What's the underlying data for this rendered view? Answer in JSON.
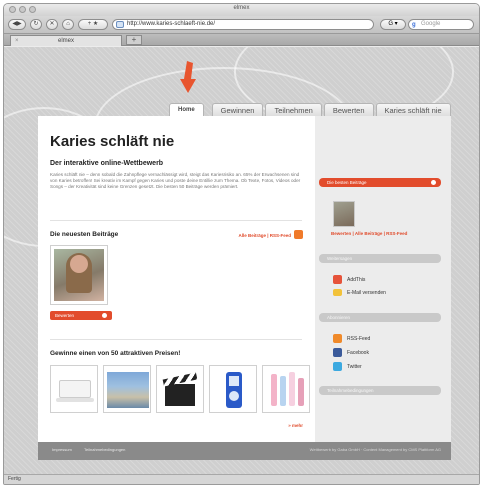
{
  "window": {
    "title": "elmex"
  },
  "toolbar": {
    "url": "http://www.karies-schlaeft-nie.de/",
    "search_engine": "Google",
    "search_placeholder": "Google"
  },
  "browser_tab": {
    "label": "elmex"
  },
  "nav_tabs": [
    {
      "label": "Home",
      "active": true
    },
    {
      "label": "Gewinnen",
      "active": false
    },
    {
      "label": "Teilnehmen",
      "active": false
    },
    {
      "label": "Bewerten",
      "active": false
    },
    {
      "label": "Karies schläft nie",
      "active": false
    }
  ],
  "main": {
    "title": "Karies schläft nie",
    "subtitle": "Der interaktive online-Wettbewerb",
    "intro": "Karies schläft nie – denn sobald die Zahnpflege vernachlässigt wird, steigt das Kariesrisiko an. 65% der Erwachsenen sind von Karies betroffen! Sei kreativ im Kampf gegen Karies und poste deine Entillie zum Thema. Ob Texte, Fotos, Videos oder Songs – der Kreativität sind keine Grenzen gesetzt. Die besten 50 Beiträge werden prämiert.",
    "newest_heading": "Die neuesten Beiträge",
    "newest_links": "Alle Beiträge  |  RSS-Feed",
    "rate_button": "Bewerten",
    "prizes_heading": "Gewinne einen von 50 attraktiven Preisen!",
    "more_link": "» mehr"
  },
  "sidebar": {
    "best_heading": "Die besten Beiträge",
    "best_links": "Bewerten  |  Alle Beiträge  |  RSS-Feed",
    "box2": "Weitersagen",
    "share": [
      {
        "label": "AddThis",
        "color": "#e6533a"
      },
      {
        "label": "E-Mail versenden",
        "color": "#f2c23a"
      }
    ],
    "box3": "Abonnieren",
    "subscribe": [
      {
        "label": "RSS-Feed",
        "color": "#f08a2a"
      },
      {
        "label": "Facebook",
        "color": "#3b5a9a"
      },
      {
        "label": "Twitter",
        "color": "#3ca9e0"
      }
    ],
    "box4": "Teilnahmebedingungen"
  },
  "footer": {
    "left1": "Impressum",
    "left2": "Teilnahmebedingungen",
    "right": "Wettbewerb by Gaba GmbH · Content Management by CMS Plattform AG"
  },
  "statusbar": {
    "text": "Fertig"
  },
  "colors": {
    "accent": "#e24c2c"
  }
}
